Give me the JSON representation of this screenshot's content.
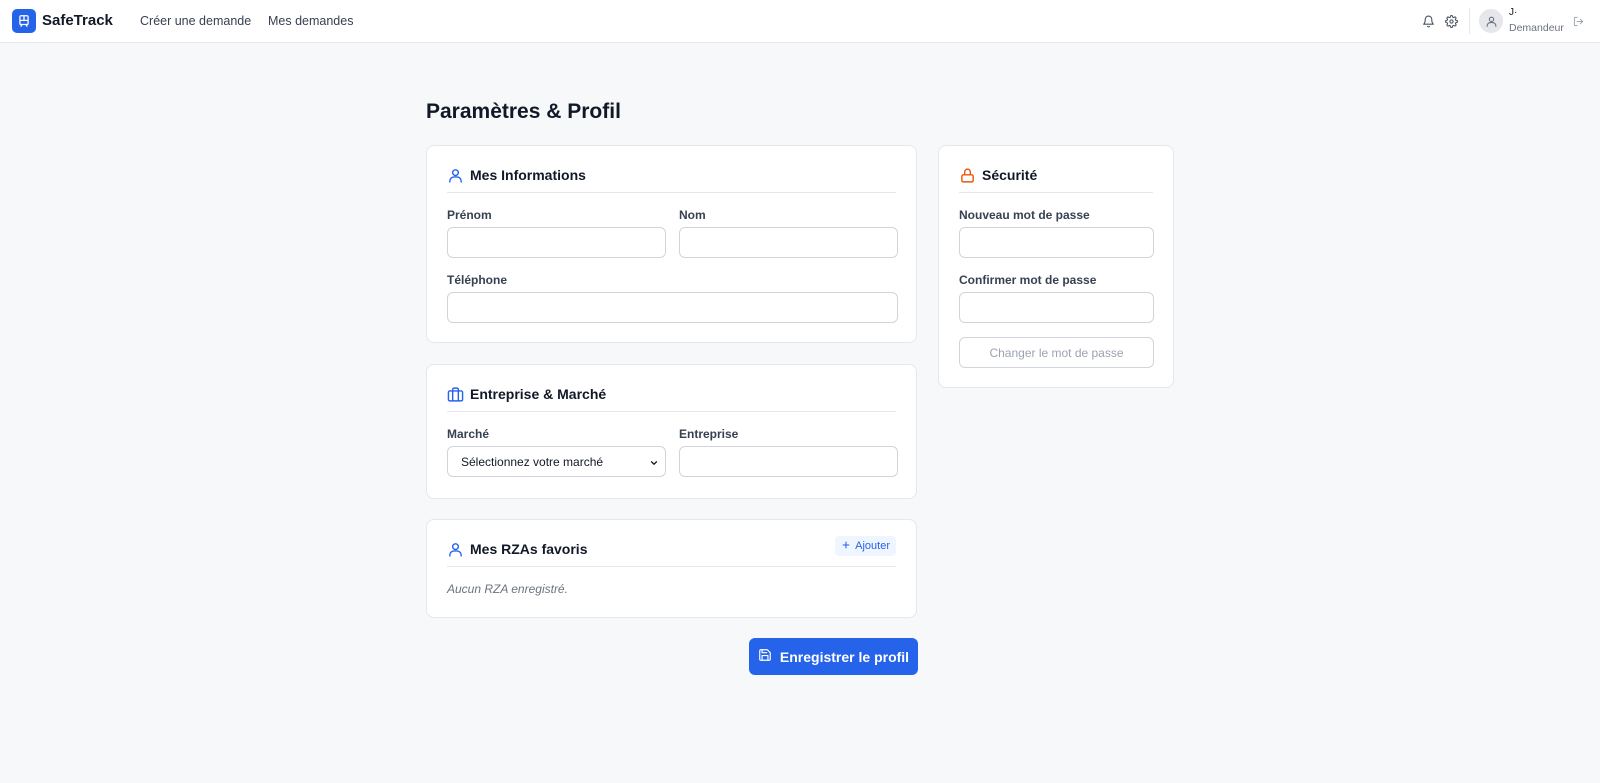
{
  "app": {
    "brand": "SafeTrack"
  },
  "nav": {
    "create_request": "Créer une demande",
    "my_requests": "Mes demandes"
  },
  "user": {
    "name": "J·",
    "role": "Demandeur"
  },
  "icons": {
    "logo": "bus-icon",
    "notifications": "bell-icon",
    "settings": "gear-icon",
    "avatar": "user-icon",
    "logout": "logout-icon",
    "info": "user-icon",
    "company": "briefcase-icon",
    "favorites": "user-icon",
    "security": "lock-icon",
    "add": "plus-icon",
    "save": "save-icon"
  },
  "colors": {
    "accent": "#2563eb",
    "security_accent": "#ea580c",
    "background": "#f7f8fa"
  },
  "page": {
    "title": "Paramètres & Profil"
  },
  "info_card": {
    "title": "Mes Informations",
    "first_name_label": "Prénom",
    "first_name_value": "",
    "last_name_label": "Nom",
    "last_name_value": "",
    "phone_label": "Téléphone",
    "phone_value": ""
  },
  "company_card": {
    "title": "Entreprise & Marché",
    "market_label": "Marché",
    "market_selected": "Sélectionnez votre marché",
    "company_label": "Entreprise",
    "company_value": ""
  },
  "favorites_card": {
    "title": "Mes RZAs favoris",
    "add_label": "Ajouter",
    "empty_text": "Aucun RZA enregistré."
  },
  "security_card": {
    "title": "Sécurité",
    "new_password_label": "Nouveau mot de passe",
    "confirm_password_label": "Confirmer mot de passe",
    "change_button": "Changer le mot de passe"
  },
  "save_button": "Enregistrer le profil"
}
